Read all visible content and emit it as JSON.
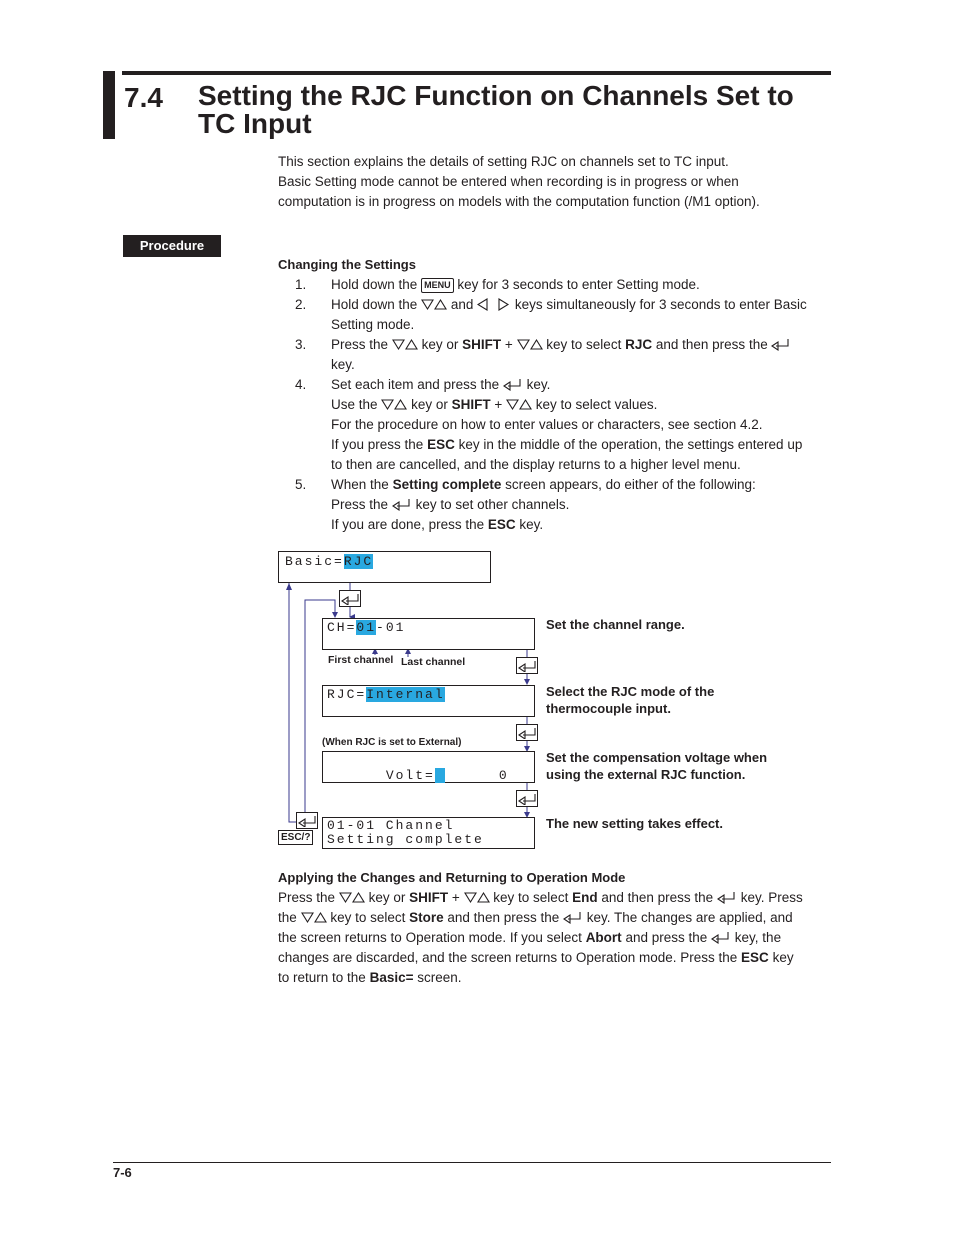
{
  "section": {
    "number": "7.4",
    "title": "Setting the RJC Function on Channels Set to TC Input"
  },
  "intro": [
    "This section explains the details of setting RJC on channels set to TC input.",
    "Basic Setting mode cannot be entered when recording is in progress or when",
    "computation is in progress on models with the computation function (/M1 option)."
  ],
  "procedure_badge": "Procedure",
  "changing": {
    "heading": "Changing the Settings",
    "steps": [
      {
        "num": "1.",
        "t1": "Hold down the",
        "key": "MENU",
        "t2": "key for 3 seconds to enter Setting mode."
      },
      {
        "num": "2.",
        "t1": "Hold down the",
        "t2": "and",
        "t3": "keys simultaneously for 3 seconds to enter Basic",
        "t4": "Setting mode."
      },
      {
        "num": "3.",
        "t1": "Press the",
        "t2": "key or",
        "b1": "SHIFT",
        "t3": "+",
        "t4": "key to select",
        "b2": "RJC",
        "t5": "and then press the",
        "t6": "key."
      },
      {
        "num": "4.",
        "t1": "Set each item and press the",
        "t2": "key.",
        "t3": "Use the",
        "t4": "key or",
        "b1": "SHIFT",
        "t5": "+",
        "t6": "key to select values.",
        "t7": "For the procedure on how to enter values or characters, see section 4.2.",
        "t8": "If you press the",
        "b2": "ESC",
        "t9": "key in the middle of the operation, the settings entered up",
        "t10": "to then are cancelled, and the display returns to a higher level menu."
      },
      {
        "num": "5.",
        "t1": "When the",
        "b1": "Setting complete",
        "t2": "screen appears, do either of the following:",
        "t3": "Press the",
        "t4": "key to set other channels.",
        "t5": "If you are done, press the",
        "b2": "ESC",
        "t6": "key."
      }
    ]
  },
  "diagram": {
    "basic_prefix": "Basic=",
    "basic_value": "RJC",
    "ch_prefix": "CH=",
    "ch_first": "01",
    "ch_rest": "-01",
    "first_channel_label": "First channel",
    "last_channel_label": "Last channel",
    "rjc_prefix": "RJC=",
    "rjc_value": "Internal",
    "external_note": "(When RJC is set to External)",
    "volt_prefix": "Volt=",
    "volt_value": "0",
    "complete_line1": "01-01 Channel",
    "complete_line2": "Setting complete",
    "esc_key": "ESC/?",
    "desc_channel_range": "Set the channel range.",
    "desc_rjc_mode": [
      "Select the RJC mode of the",
      "thermocouple input."
    ],
    "desc_comp_voltage": [
      "Set the compensation voltage when",
      "using the external RJC function."
    ],
    "desc_takes_effect": "The new setting takes effect."
  },
  "applying": {
    "heading": "Applying the Changes and Returning to Operation Mode",
    "p": {
      "a1": "Press the",
      "a2": "key or",
      "a3": "SHIFT",
      "a4": "+",
      "a5": "key to select",
      "a6": "End",
      "a7": "and then press the",
      "a8": "key.  Press",
      "b1": "the",
      "b2": "key to select",
      "b3": "Store",
      "b4": "and then press the",
      "b5": "key.  The changes are applied, and",
      "c1": "the screen returns to Operation mode.  If you select",
      "c2": "Abort",
      "c3": "and press the",
      "c4": "key, the",
      "d1": "changes are discarded, and the screen returns to Operation mode.  Press the",
      "d2": "ESC",
      "d3": "key",
      "e1": "to return to the",
      "e2": "Basic=",
      "e3": "screen."
    }
  },
  "footer": {
    "page": "7-6"
  },
  "colors": {
    "highlight": "#29a8e0",
    "arrow": "#3a3a8c",
    "text": "#231f20"
  }
}
